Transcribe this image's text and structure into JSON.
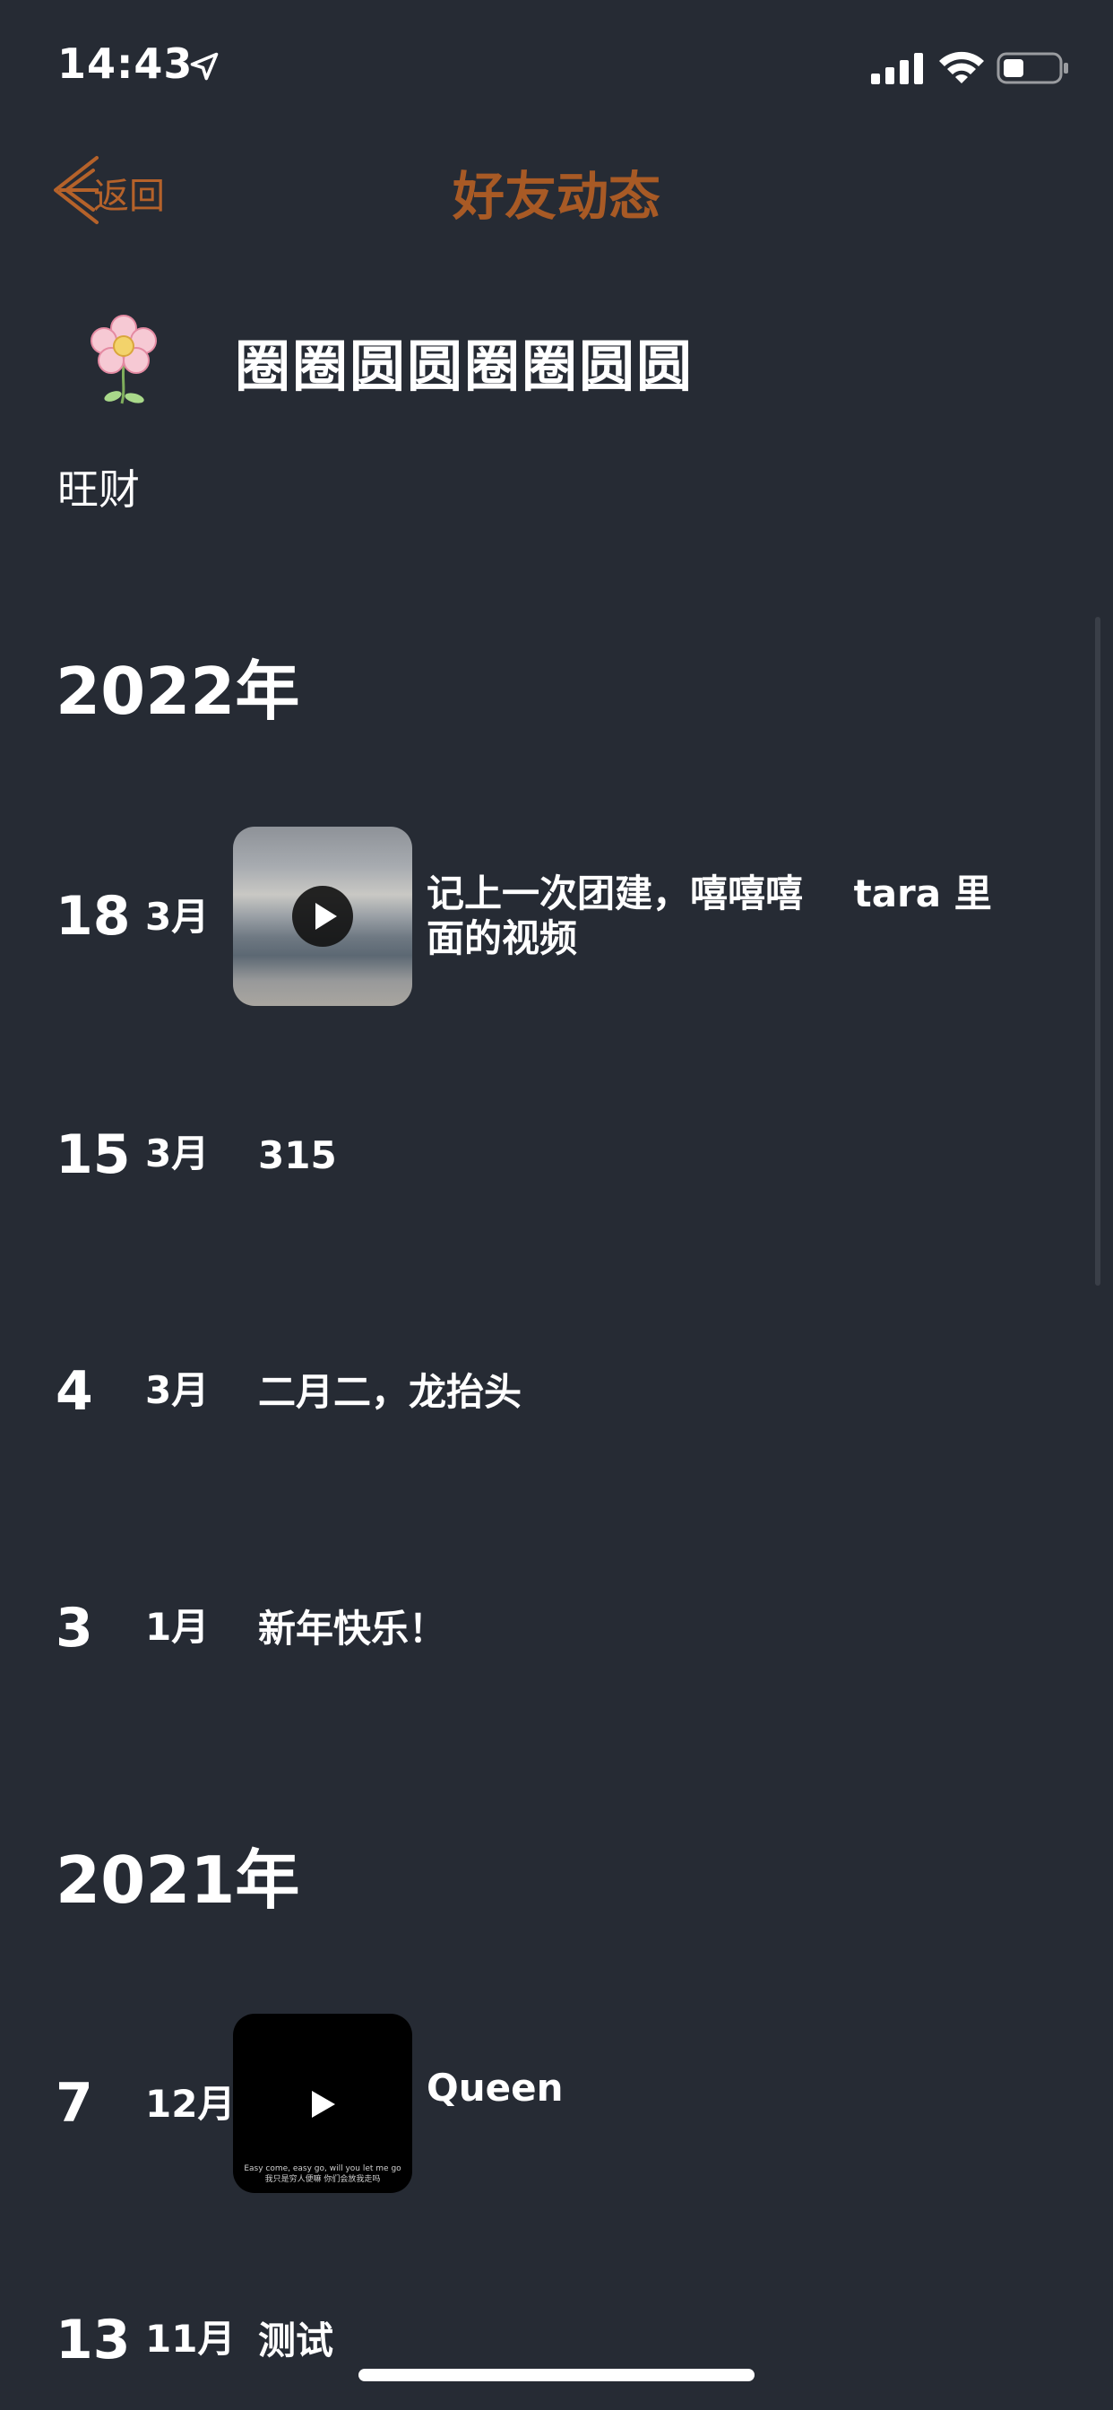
{
  "status_bar": {
    "time": "14:43",
    "location_icon": "location-arrow-icon",
    "signal_icon": "cellular-signal-icon",
    "wifi_icon": "wifi-icon",
    "battery_icon": "battery-icon",
    "battery_level": 0.3
  },
  "nav": {
    "back_label": "返回",
    "back_icon": "back-arrow-icon",
    "title": "好友动态",
    "accent_color": "#b5622a"
  },
  "profile": {
    "avatar_icon": "flower-icon",
    "name": "圈圈圆圆圈圈圆圆",
    "subtitle": "旺财"
  },
  "timeline": {
    "year_2022": "2022年",
    "year_2021": "2021年",
    "entries": [
      {
        "day": "18",
        "month": "3月",
        "text": "记上一次团建，嘻嘻嘻　 tara 里面的视频",
        "has_video": true
      },
      {
        "day": "15",
        "month": "3月",
        "text": "315"
      },
      {
        "day": "4",
        "month": "3月",
        "text": "二月二，龙抬头"
      },
      {
        "day": "3",
        "month": "1月",
        "text": "新年快乐！"
      },
      {
        "day": "7",
        "month": "12月",
        "text": "Queen",
        "has_video": true,
        "video_caption_1": "Easy come, easy go, will you let me go",
        "video_caption_2": "我只是穷人便嘛 你们会放我走吗"
      },
      {
        "day": "13",
        "month": "11月",
        "text": "测试"
      }
    ]
  },
  "colors": {
    "background": "#262b34",
    "title_color": "#a85a25"
  }
}
